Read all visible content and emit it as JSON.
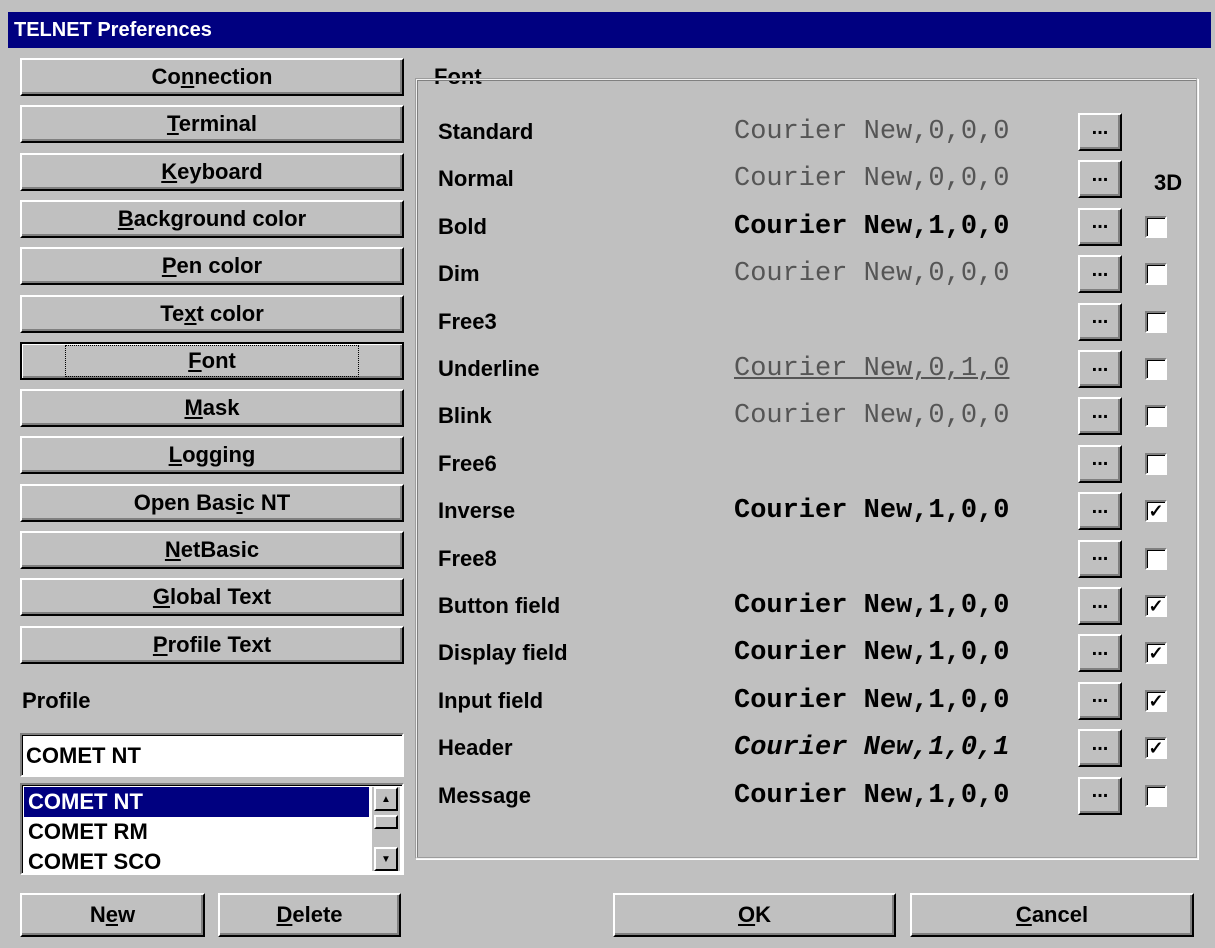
{
  "window": {
    "title": "TELNET Preferences"
  },
  "nav": {
    "items": [
      {
        "pre": "Co",
        "u": "n",
        "post": "nection"
      },
      {
        "pre": "",
        "u": "T",
        "post": "erminal"
      },
      {
        "pre": "",
        "u": "K",
        "post": "eyboard"
      },
      {
        "pre": "",
        "u": "B",
        "post": "ackground color"
      },
      {
        "pre": "",
        "u": "P",
        "post": "en color"
      },
      {
        "pre": "Te",
        "u": "x",
        "post": "t color"
      },
      {
        "pre": "",
        "u": "F",
        "post": "ont"
      },
      {
        "pre": "",
        "u": "M",
        "post": "ask"
      },
      {
        "pre": "",
        "u": "L",
        "post": "ogging"
      },
      {
        "pre": "Open Bas",
        "u": "i",
        "post": "c NT"
      },
      {
        "pre": "",
        "u": "N",
        "post": "etBasic"
      },
      {
        "pre": "",
        "u": "G",
        "post": "lobal Text"
      },
      {
        "pre": "",
        "u": "P",
        "post": "rofile Text"
      }
    ],
    "active_index": 6
  },
  "profile": {
    "label": "Profile",
    "input_value": "COMET NT",
    "list": [
      "COMET NT",
      "COMET RM",
      "COMET SCO"
    ],
    "selected_index": 0
  },
  "font_group": {
    "title": "Font",
    "header_3d": "3D",
    "rows": [
      {
        "label": "Standard",
        "value": "Courier New,0,0,0",
        "style": "normal",
        "checkbox": null
      },
      {
        "label": "Normal",
        "value": "Courier New,0,0,0",
        "style": "normal",
        "checkbox": null
      },
      {
        "label": "Bold",
        "value": "Courier New,1,0,0",
        "style": "bold",
        "checkbox": false
      },
      {
        "label": "Dim",
        "value": "Courier New,0,0,0",
        "style": "normal",
        "checkbox": false
      },
      {
        "label": "Free3",
        "value": "",
        "style": "normal",
        "checkbox": false
      },
      {
        "label": "Underline",
        "value": "Courier New,0,1,0",
        "style": "uline",
        "checkbox": false
      },
      {
        "label": "Blink",
        "value": "Courier New,0,0,0",
        "style": "normal",
        "checkbox": false
      },
      {
        "label": "Free6",
        "value": "",
        "style": "normal",
        "checkbox": false
      },
      {
        "label": "Inverse",
        "value": "Courier New,1,0,0",
        "style": "bold",
        "checkbox": true
      },
      {
        "label": "Free8",
        "value": "",
        "style": "normal",
        "checkbox": false
      },
      {
        "label": "Button field",
        "value": "Courier New,1,0,0",
        "style": "bold",
        "checkbox": true
      },
      {
        "label": "Display field",
        "value": "Courier New,1,0,0",
        "style": "bold",
        "checkbox": true
      },
      {
        "label": "Input field",
        "value": "Courier New,1,0,0",
        "style": "bold",
        "checkbox": true
      },
      {
        "label": "Header",
        "value": "Courier New,1,0,1",
        "style": "italic",
        "checkbox": true
      },
      {
        "label": "Message",
        "value": "Courier New,1,0,0",
        "style": "bold",
        "checkbox": false
      }
    ],
    "browse_label": "...",
    "check_mark": "✓"
  },
  "buttons": {
    "new": {
      "pre": "N",
      "u": "e",
      "post": "w"
    },
    "delete": {
      "pre": "",
      "u": "D",
      "post": "elete"
    },
    "ok": {
      "pre": "",
      "u": "O",
      "post": "K"
    },
    "cancel": {
      "pre": "",
      "u": "C",
      "post": "ancel"
    }
  }
}
